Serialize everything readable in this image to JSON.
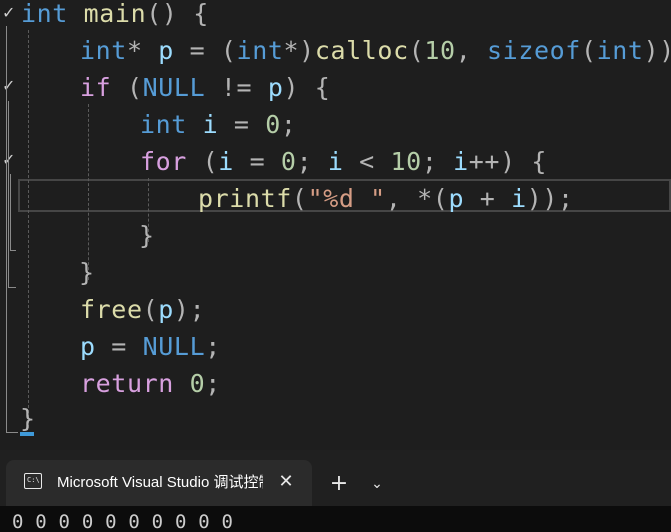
{
  "editor": {
    "lines": [
      {
        "tokens": [
          {
            "t": "int",
            "c": "kw"
          },
          {
            "t": " ",
            "c": "plain"
          },
          {
            "t": "main",
            "c": "fn"
          },
          {
            "t": "() {",
            "c": "op"
          }
        ]
      },
      {
        "tokens": [
          {
            "t": "int",
            "c": "kw"
          },
          {
            "t": "* ",
            "c": "op"
          },
          {
            "t": "p",
            "c": "var"
          },
          {
            "t": " = (",
            "c": "op"
          },
          {
            "t": "int",
            "c": "kw"
          },
          {
            "t": "*)",
            "c": "op"
          },
          {
            "t": "calloc",
            "c": "fn"
          },
          {
            "t": "(",
            "c": "op"
          },
          {
            "t": "10",
            "c": "num"
          },
          {
            "t": ", ",
            "c": "op"
          },
          {
            "t": "sizeof",
            "c": "kw"
          },
          {
            "t": "(",
            "c": "op"
          },
          {
            "t": "int",
            "c": "kw"
          },
          {
            "t": "));",
            "c": "op"
          }
        ]
      },
      {
        "tokens": [
          {
            "t": "if",
            "c": "ctl"
          },
          {
            "t": " (",
            "c": "op"
          },
          {
            "t": "NULL",
            "c": "kw"
          },
          {
            "t": " != ",
            "c": "op"
          },
          {
            "t": "p",
            "c": "var"
          },
          {
            "t": ") {",
            "c": "op"
          }
        ]
      },
      {
        "tokens": [
          {
            "t": "int",
            "c": "kw"
          },
          {
            "t": " ",
            "c": "plain"
          },
          {
            "t": "i",
            "c": "var"
          },
          {
            "t": " = ",
            "c": "op"
          },
          {
            "t": "0",
            "c": "num"
          },
          {
            "t": ";",
            "c": "op"
          }
        ]
      },
      {
        "tokens": [
          {
            "t": "for",
            "c": "ctl"
          },
          {
            "t": " (",
            "c": "op"
          },
          {
            "t": "i",
            "c": "var"
          },
          {
            "t": " = ",
            "c": "op"
          },
          {
            "t": "0",
            "c": "num"
          },
          {
            "t": "; ",
            "c": "op"
          },
          {
            "t": "i",
            "c": "var"
          },
          {
            "t": " < ",
            "c": "op"
          },
          {
            "t": "10",
            "c": "num"
          },
          {
            "t": "; ",
            "c": "op"
          },
          {
            "t": "i",
            "c": "var"
          },
          {
            "t": "++) {",
            "c": "op"
          }
        ]
      },
      {
        "tokens": [
          {
            "t": "printf",
            "c": "fn"
          },
          {
            "t": "(",
            "c": "op"
          },
          {
            "t": "\"%d \"",
            "c": "str"
          },
          {
            "t": ", *(",
            "c": "op"
          },
          {
            "t": "p",
            "c": "var"
          },
          {
            "t": " + ",
            "c": "op"
          },
          {
            "t": "i",
            "c": "var"
          },
          {
            "t": "));",
            "c": "op"
          }
        ]
      },
      {
        "tokens": [
          {
            "t": "}",
            "c": "op"
          }
        ]
      },
      {
        "tokens": [
          {
            "t": "}",
            "c": "op"
          }
        ]
      },
      {
        "tokens": [
          {
            "t": "free",
            "c": "fn"
          },
          {
            "t": "(",
            "c": "op"
          },
          {
            "t": "p",
            "c": "var"
          },
          {
            "t": ");",
            "c": "op"
          }
        ]
      },
      {
        "tokens": [
          {
            "t": "p",
            "c": "var"
          },
          {
            "t": " = ",
            "c": "op"
          },
          {
            "t": "NULL",
            "c": "kw"
          },
          {
            "t": ";",
            "c": "op"
          }
        ]
      },
      {
        "tokens": [
          {
            "t": "return",
            "c": "ctl"
          },
          {
            "t": " ",
            "c": "plain"
          },
          {
            "t": "0",
            "c": "num"
          },
          {
            "t": ";",
            "c": "op"
          }
        ]
      },
      {
        "tokens": [
          {
            "t": "}",
            "c": "op"
          }
        ]
      }
    ],
    "fold_glyph": "✓"
  },
  "console": {
    "tab_title": "Microsoft Visual Studio 调试控制台",
    "tab_icon_text": "C:\\",
    "close_glyph": "✕",
    "new_tab_glyph": "+",
    "menu_glyph": "⌄",
    "output": "0 0 0 0 0 0 0 0 0 0"
  },
  "colors": {
    "editor_bg": "#1e1e1e",
    "keyword": "#569cd6",
    "control": "#d8a0df",
    "function": "#dcdcaa",
    "variable": "#9cdcfe",
    "number": "#b5cea8",
    "string": "#d69d85",
    "console_bg": "#0c0c0c"
  }
}
